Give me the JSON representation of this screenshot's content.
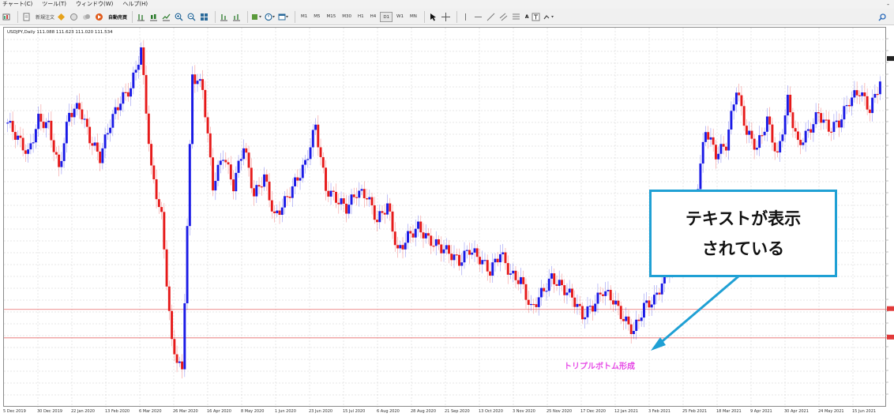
{
  "menubar": {
    "items": [
      "チャート(C)",
      "ツール(T)",
      "ウィンドウ(W)",
      "ヘルプ(H)"
    ],
    "minimize": "-"
  },
  "toolbar": {
    "new_order": "新規注文",
    "auto_trading": "自動売買",
    "timeframes": [
      "M1",
      "M5",
      "M15",
      "M30",
      "H1",
      "H4",
      "D1",
      "W1",
      "MN"
    ],
    "active_timeframe": "D1",
    "text_tool": "A"
  },
  "chart": {
    "info": "USDJPY,Daily 111.088 111.623 111.020 111.534"
  },
  "chart_data": {
    "type": "candlestick",
    "symbol": "USDJPY",
    "timeframe": "Daily",
    "x_tick_labels": [
      "5 Dec 2019",
      "30 Dec 2019",
      "22 Jan 2020",
      "13 Feb 2020",
      "6 Mar 2020",
      "26 Mar 2020",
      "16 Apr 2020",
      "8 May 2020",
      "1 Jun 2020",
      "23 Jun 2020",
      "15 Jul 2020",
      "6 Aug 2020",
      "28 Aug 2020",
      "21 Sep 2020",
      "13 Oct 2020",
      "3 Nov 2020",
      "25 Nov 2020",
      "17 Dec 2020",
      "12 Jan 2021",
      "3 Feb 2021",
      "25 Feb 2021",
      "18 Mar 2021",
      "9 Apr 2021",
      "30 Apr 2021",
      "24 May 2021",
      "15 Jun 2021"
    ],
    "close_trace": [
      109.5,
      109.0,
      108.5,
      109.6,
      109.4,
      108.0,
      109.8,
      110.0,
      109.0,
      108.4,
      109.5,
      110.2,
      110.6,
      111.8,
      108.0,
      106.5,
      102.5,
      101.6,
      111.0,
      110.6,
      107.5,
      108.5,
      107.5,
      108.8,
      107.2,
      107.8,
      106.5,
      107.0,
      107.6,
      108.2,
      109.4,
      107.4,
      107.1,
      106.8,
      107.3,
      107.2,
      106.4,
      106.9,
      105.4,
      105.9,
      106.2,
      105.8,
      105.6,
      105.4,
      105.1,
      105.5,
      105.2,
      104.8,
      105.4,
      104.7,
      104.5,
      103.6,
      104.1,
      104.6,
      104.3,
      104.0,
      103.4,
      103.7,
      104.2,
      103.9,
      103.3,
      102.9,
      103.7,
      103.9,
      104.6,
      105.3,
      106.3,
      107.0,
      109.3,
      108.5,
      108.8,
      110.6,
      109.2,
      108.7,
      109.6,
      108.4,
      110.2,
      108.8,
      109.2,
      109.8,
      109.3,
      109.5,
      110.2,
      110.5,
      109.9,
      110.8
    ],
    "horizontal_lines": [
      "upper",
      "lower"
    ],
    "colors": {
      "bull": "#1a1ae6",
      "bear": "#e61a1a",
      "line": "#e86a6a",
      "grid": "#cfcfcf"
    }
  },
  "callout": {
    "line1": "テキストが表示",
    "line2": "されている",
    "border_color": "#1fa0d4"
  },
  "annotation": {
    "text": "トリプルボトム形成",
    "color": "#e64ce6"
  }
}
